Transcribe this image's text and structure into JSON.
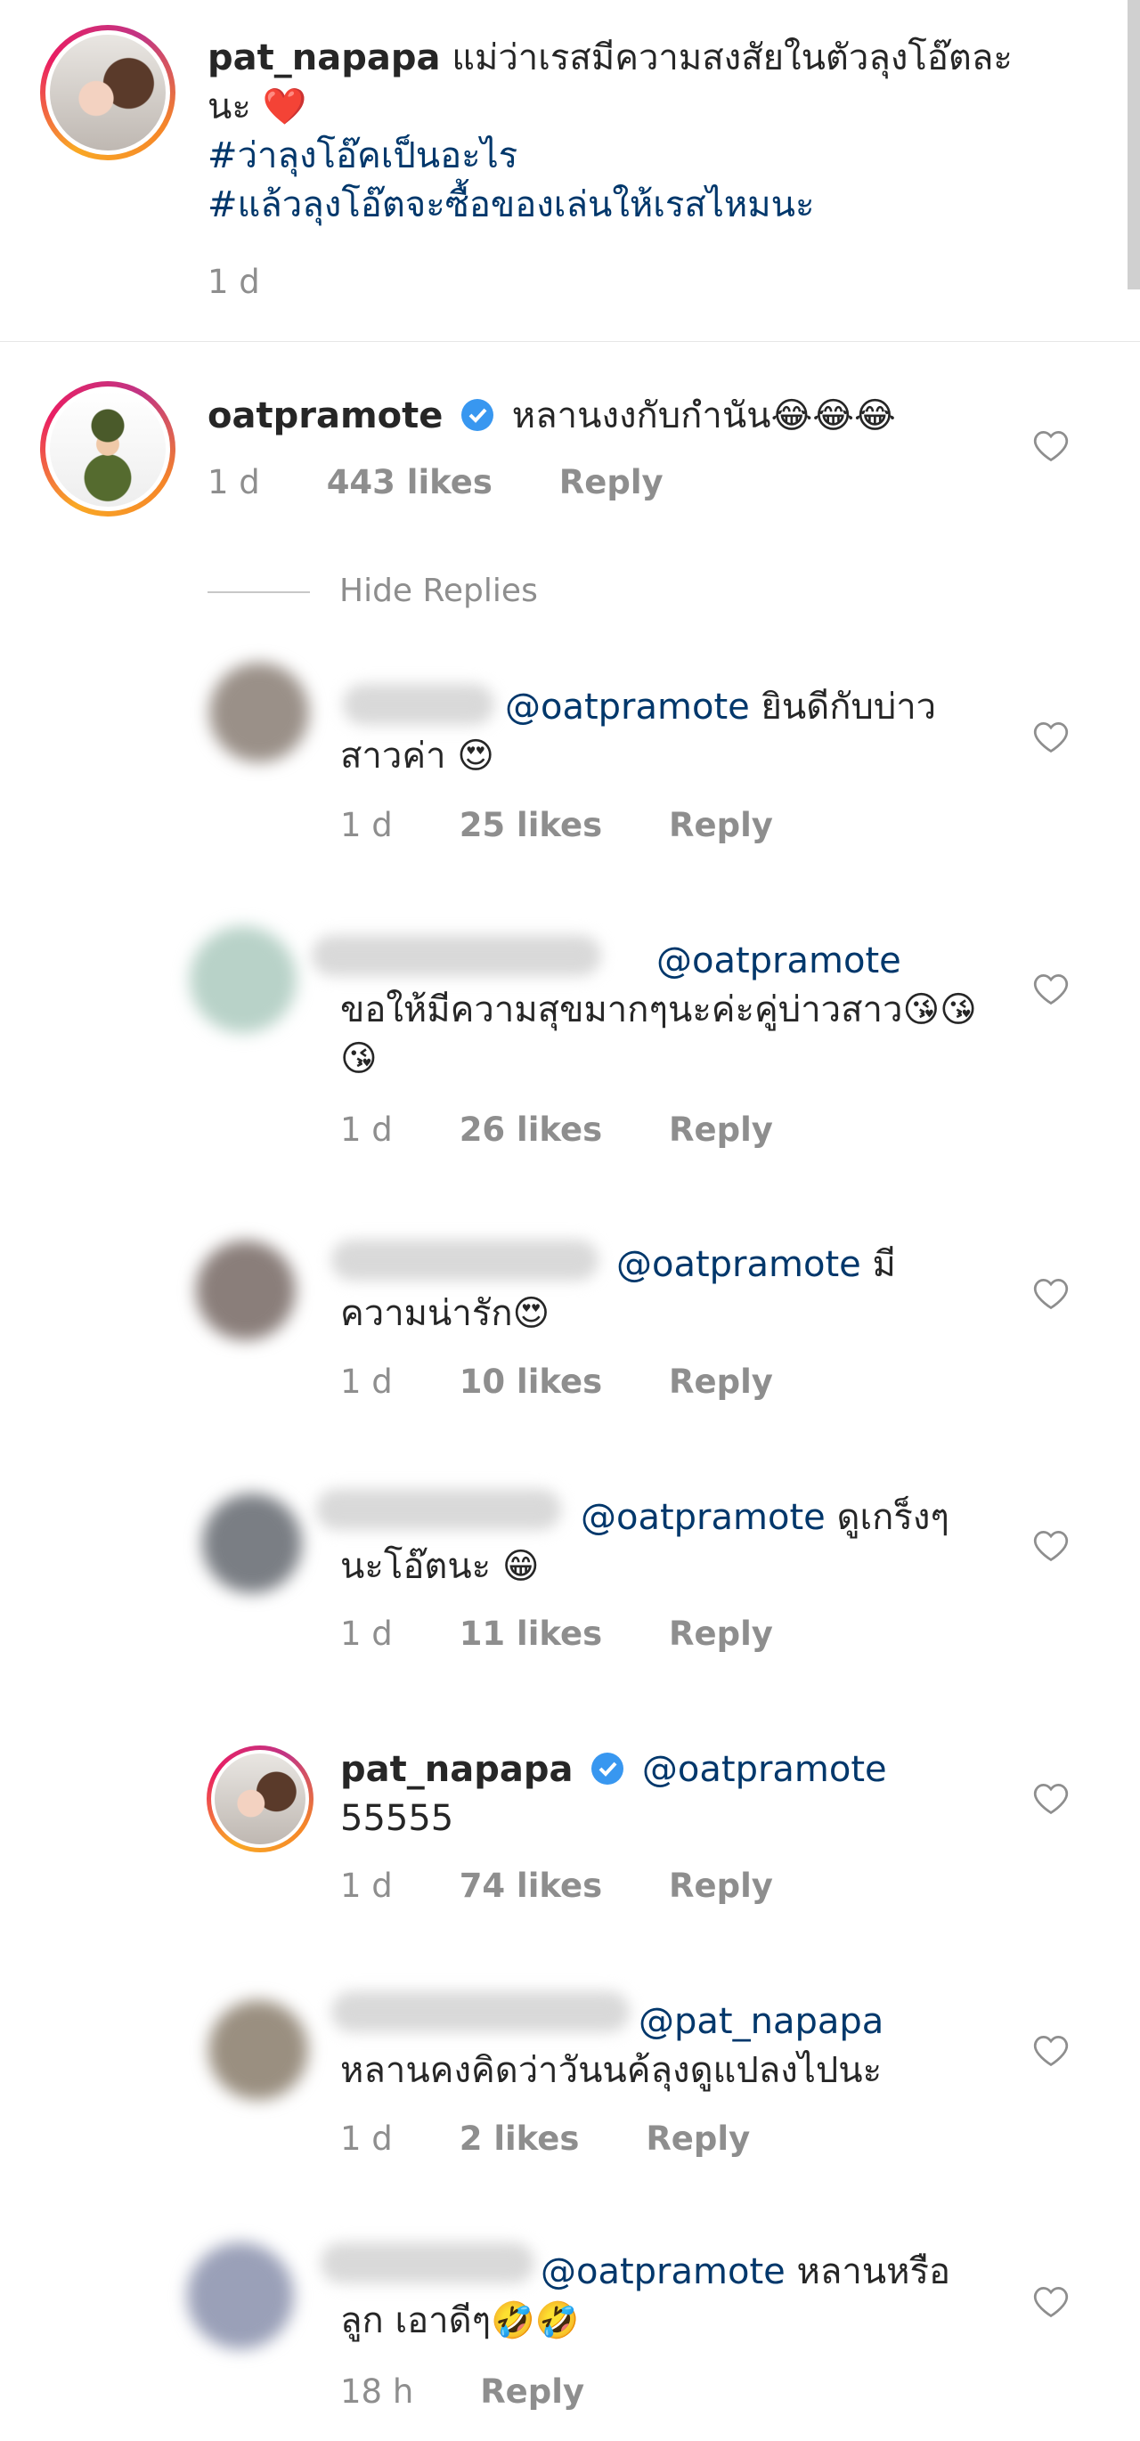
{
  "caption": {
    "username": "pat_napapa",
    "text": "แม่ว่าเรสมีความสงสัยในตัวลุงโอ๊ตละนะ ❤️",
    "hashtag1": "#ว่าลุงโอ๊คเป็นอะไร",
    "hashtag2": "#แล้วลุงโอ๊ตจะซื้อของเล่นให้เรสไหมนะ",
    "time": "1 d"
  },
  "comment": {
    "username": "oatpramote",
    "text": "หลานงงกับกำนัน😂😂😂",
    "time": "1 d",
    "likes": "443 likes",
    "reply": "Reply"
  },
  "hide_replies": "Hide Replies",
  "replies": [
    {
      "mention": "@oatpramote",
      "text": " ยินดีกับบ่าวสาวค่า 😍",
      "time": "1 d",
      "likes": "25 likes",
      "reply": "Reply"
    },
    {
      "mention": "@oatpramote",
      "text": "ขอให้มีความสุขมากๆนะค่ะคู่บ่าวสาว😘😘😘",
      "time": "1 d",
      "likes": "26 likes",
      "reply": "Reply"
    },
    {
      "mention": "@oatpramote",
      "text": " มีความน่ารัก😍",
      "time": "1 d",
      "likes": "10 likes",
      "reply": "Reply"
    },
    {
      "mention": "@oatpramote",
      "text": " ดูเกร็งๆนะโอ๊ตนะ 😁",
      "time": "1 d",
      "likes": "11 likes",
      "reply": "Reply"
    },
    {
      "username": "pat_napapa",
      "mention": "@oatpramote",
      "text": "55555",
      "time": "1 d",
      "likes": "74 likes",
      "reply": "Reply"
    },
    {
      "mention": "@pat_napapa",
      "text": "หลานคงคิดว่าวันนค้ลุงดูแปลงไปนะ",
      "time": "1 d",
      "likes": "2 likes",
      "reply": "Reply"
    },
    {
      "mention": "@oatpramote",
      "text": " หลานหรือลูก เอาดีๆ🤣🤣",
      "time": "18 h",
      "reply": "Reply"
    }
  ],
  "colors": {
    "link": "#00376b",
    "meta": "#8e8e8e",
    "verified": "#3897f0"
  }
}
